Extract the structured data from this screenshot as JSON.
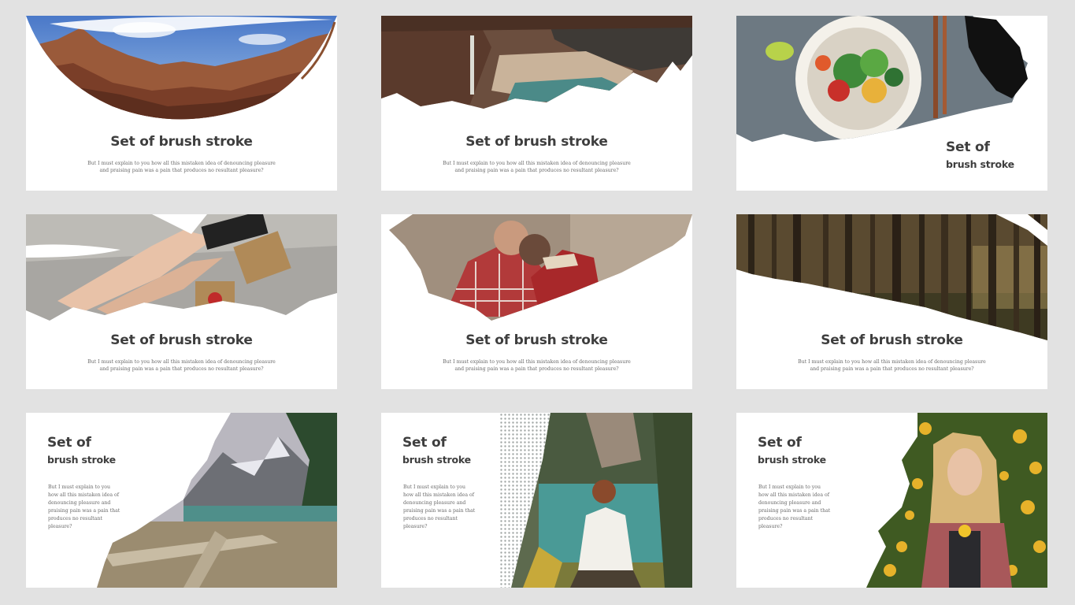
{
  "slides": [
    {
      "title": "Set of brush stroke",
      "body": "But I must explain to you how all this mistaken idea of denouncing pleasure and praising pain was a pain that produces no resultant pleasure?",
      "image": "canyon-landscape-photo"
    },
    {
      "title": "Set of brush stroke",
      "body": "But I must explain to you how all this mistaken idea of denouncing pleasure and praising pain was a pain that produces no resultant pleasure?",
      "image": "waterfall-coast-photo"
    },
    {
      "title_line1": "Set of",
      "title_line2": "brush stroke",
      "image": "salad-bowl-photo"
    },
    {
      "title": "Set of brush stroke",
      "body": "But I must explain to you how all this mistaken idea of denouncing pleasure and praising pain was a pain that produces no resultant pleasure?",
      "image": "legs-blanket-gift-photo"
    },
    {
      "title": "Set of brush stroke",
      "body": "But I must explain to you how all this mistaken idea of denouncing pleasure and praising pain was a pain that produces no resultant pleasure?",
      "image": "couple-hugging-photo"
    },
    {
      "title": "Set of brush stroke",
      "body": "But I must explain to you how all this mistaken idea of denouncing pleasure and praising pain was a pain that produces no resultant pleasure?",
      "image": "pine-forest-photo"
    },
    {
      "title_line1": "Set of",
      "title_line2": "brush stroke",
      "body": "But I must explain to you how all this mistaken idea of denouncing pleasure and praising pain was a pain that produces no resultant pleasure?",
      "image": "mountain-lake-driftwood-photo"
    },
    {
      "title_line1": "Set of",
      "title_line2": "brush stroke",
      "body": "But I must explain to you how all this mistaken idea of denouncing pleasure and praising pain was a pain that produces no resultant pleasure?",
      "image": "woman-by-lake-photo"
    },
    {
      "title_line1": "Set of",
      "title_line2": "brush stroke",
      "body": "But I must explain to you how all this mistaken idea of denouncing pleasure and praising pain was a pain that produces no resultant pleasure?",
      "image": "woman-with-flowers-photo"
    }
  ]
}
